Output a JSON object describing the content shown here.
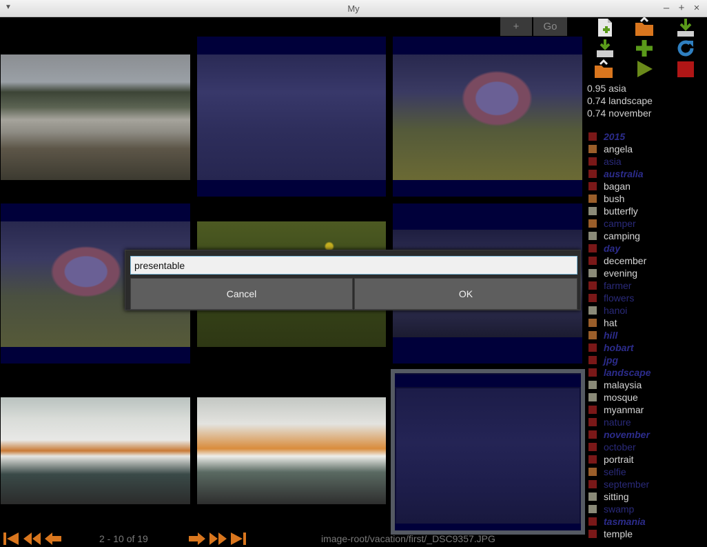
{
  "window": {
    "title": "My"
  },
  "toolbar": {
    "plus_label": "+",
    "go_label": "Go"
  },
  "tools": [
    "new-file-icon",
    "folder-open-icon",
    "download-icon",
    "import-icon",
    "add-icon",
    "refresh-icon",
    "export-folder-icon",
    "play-icon",
    "stop-icon"
  ],
  "scores": [
    {
      "text": "0.95 asia"
    },
    {
      "text": "0.74 landscape"
    },
    {
      "text": "0.74 november"
    }
  ],
  "tags": [
    {
      "label": "2015",
      "swatch": "#7a1818",
      "style": "db"
    },
    {
      "label": "angela",
      "swatch": "#9a5e2a",
      "style": "n"
    },
    {
      "label": "asia",
      "swatch": "#7a1818",
      "style": "d"
    },
    {
      "label": "australia",
      "swatch": "#7a1818",
      "style": "db"
    },
    {
      "label": "bagan",
      "swatch": "#7a1818",
      "style": "n"
    },
    {
      "label": "bush",
      "swatch": "#9a5e2a",
      "style": "n"
    },
    {
      "label": "butterfly",
      "swatch": "#8a8a78",
      "style": "n"
    },
    {
      "label": "camper",
      "swatch": "#9a5e2a",
      "style": "d"
    },
    {
      "label": "camping",
      "swatch": "#8a8a78",
      "style": "n"
    },
    {
      "label": "day",
      "swatch": "#7a1818",
      "style": "db"
    },
    {
      "label": "december",
      "swatch": "#7a1818",
      "style": "n"
    },
    {
      "label": "evening",
      "swatch": "#8a8a78",
      "style": "n"
    },
    {
      "label": "farmer",
      "swatch": "#7a1818",
      "style": "d"
    },
    {
      "label": "flowers",
      "swatch": "#7a1818",
      "style": "d"
    },
    {
      "label": "hanoi",
      "swatch": "#8a8a78",
      "style": "d"
    },
    {
      "label": "hat",
      "swatch": "#9a5e2a",
      "style": "n"
    },
    {
      "label": "hill",
      "swatch": "#9a5e2a",
      "style": "db"
    },
    {
      "label": "hobart",
      "swatch": "#7a1818",
      "style": "db"
    },
    {
      "label": "jpg",
      "swatch": "#7a1818",
      "style": "db"
    },
    {
      "label": "landscape",
      "swatch": "#7a1818",
      "style": "db"
    },
    {
      "label": "malaysia",
      "swatch": "#8a8a78",
      "style": "n"
    },
    {
      "label": "mosque",
      "swatch": "#8a8a78",
      "style": "n"
    },
    {
      "label": "myanmar",
      "swatch": "#7a1818",
      "style": "n"
    },
    {
      "label": "nature",
      "swatch": "#7a1818",
      "style": "d"
    },
    {
      "label": "november",
      "swatch": "#7a1818",
      "style": "db"
    },
    {
      "label": "october",
      "swatch": "#7a1818",
      "style": "d"
    },
    {
      "label": "portrait",
      "swatch": "#7a1818",
      "style": "n"
    },
    {
      "label": "selfie",
      "swatch": "#9a5e2a",
      "style": "d"
    },
    {
      "label": "september",
      "swatch": "#7a1818",
      "style": "d"
    },
    {
      "label": "sitting",
      "swatch": "#8a8a78",
      "style": "n"
    },
    {
      "label": "swamp",
      "swatch": "#8a8a78",
      "style": "d"
    },
    {
      "label": "tasmania",
      "swatch": "#7a1818",
      "style": "db"
    },
    {
      "label": "temple",
      "swatch": "#7a1818",
      "style": "n"
    }
  ],
  "dialog": {
    "input_value": "presentable",
    "cancel_label": "Cancel",
    "ok_label": "OK"
  },
  "footer": {
    "page_info": "2 - 10 of 19",
    "path": "image-root/vacation/first/_DSC9357.JPG"
  },
  "colors": {
    "accent_orange": "#d9761e",
    "play_green": "#6a8a1a",
    "stop_red": "#b01616",
    "selected_frame": "#555a63"
  }
}
